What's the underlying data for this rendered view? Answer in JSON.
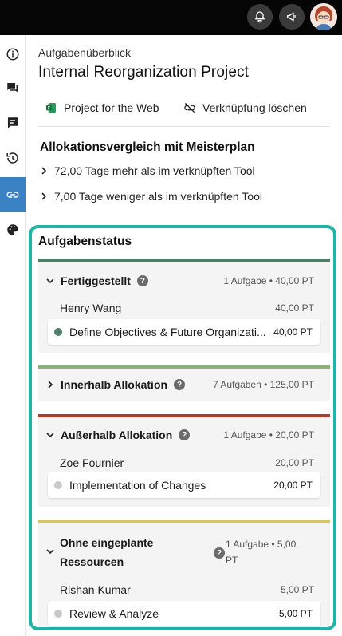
{
  "header": {
    "kicker": "Aufgabenüberblick",
    "title": "Internal Reorganization Project",
    "actions": [
      {
        "label": "Project for the Web",
        "icon": "project-icon"
      },
      {
        "label": "Verknüpfung löschen",
        "icon": "unlink-icon"
      }
    ]
  },
  "comparison": {
    "title": "Allokationsvergleich mit Meisterplan",
    "rows": [
      "72,00 Tage mehr als im verknüpften Tool",
      "7,00 Tage weniger als im verknüpften Tool"
    ]
  },
  "status": {
    "title": "Aufgabenstatus",
    "groups": [
      {
        "label": "Fertiggestellt",
        "meta": "1 Aufgabe • 40,00 PT",
        "color": "#4f7d67",
        "expanded": true,
        "person": "Henry Wang",
        "person_pt": "40,00 PT",
        "task": "Define Objectives & Future Organizati...",
        "task_pt": "40,00 PT",
        "task_dot": "#4f7d67"
      },
      {
        "label": "Innerhalb Allokation",
        "meta": "7 Aufgaben • 125,00 PT",
        "color": "#8fb07a",
        "expanded": false
      },
      {
        "label": "Außerhalb Allokation",
        "meta": "1 Aufgabe • 20,00 PT",
        "color": "#b3392b",
        "expanded": true,
        "person": "Zoe Fournier",
        "person_pt": "20,00 PT",
        "task": "Implementation of Changes",
        "task_pt": "20,00 PT",
        "task_dot": "#c8c8c8"
      },
      {
        "label_line1": "Ohne eingeplante",
        "label_line2": "Ressourcen",
        "meta_line1": "1 Aufgabe • 5,00",
        "meta_line2": "PT",
        "color": "#d9c26d",
        "expanded": true,
        "person": "Rishan Kumar",
        "person_pt": "5,00 PT",
        "task": "Review & Analyze",
        "task_pt": "5,00 PT",
        "task_dot": "#c8c8c8"
      }
    ]
  },
  "colors": {
    "accent_teal": "#21b3a6",
    "rail_active": "#3a82c4"
  }
}
